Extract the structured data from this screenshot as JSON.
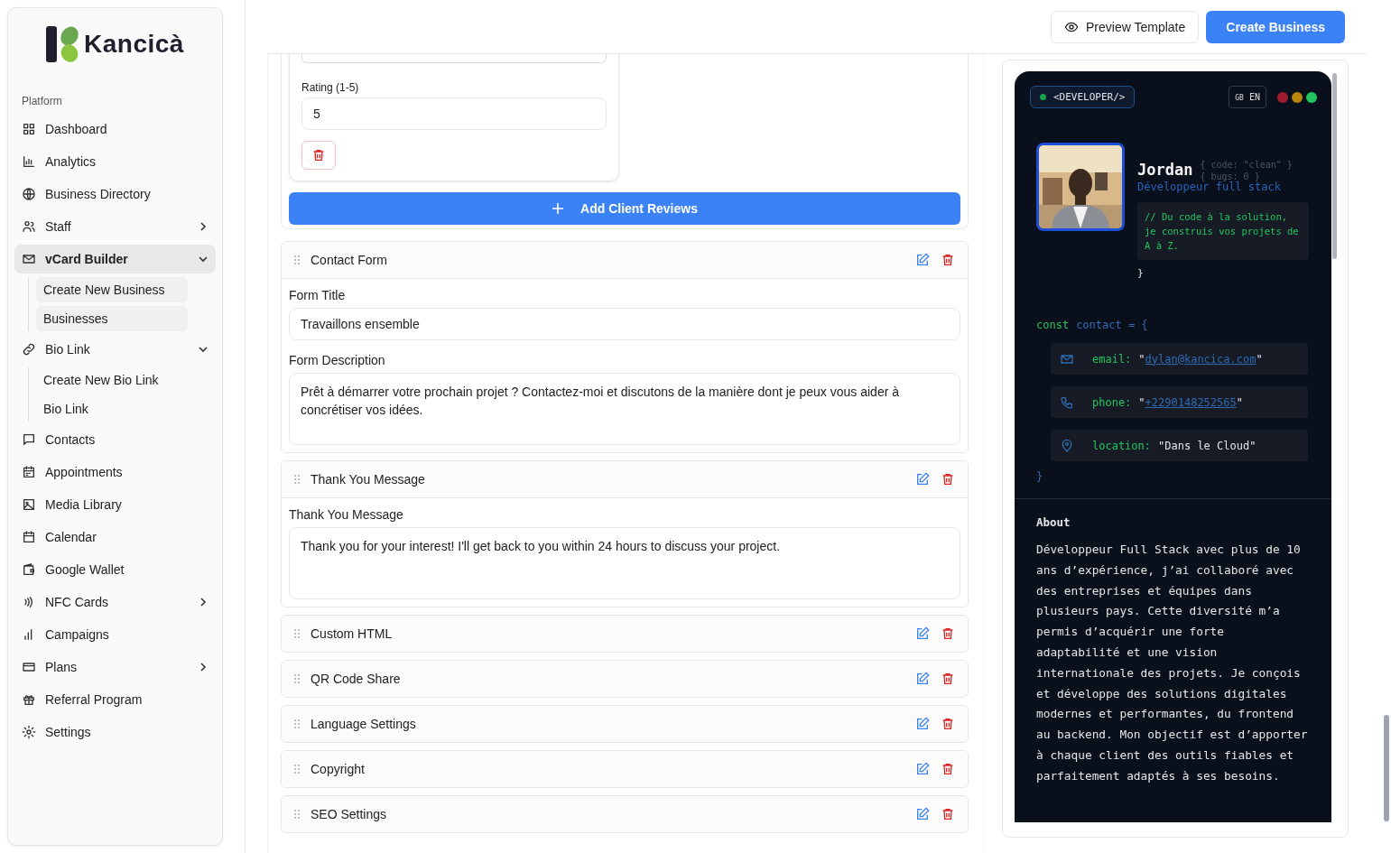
{
  "sidebar": {
    "logo": "Kancicà",
    "section": "Platform",
    "items": [
      {
        "label": "Dashboard",
        "selected": false
      },
      {
        "label": "Analytics",
        "selected": false
      },
      {
        "label": "Business Directory",
        "selected": false
      },
      {
        "label": "Staff",
        "selected": false,
        "expanded": false
      },
      {
        "label": "vCard Builder",
        "selected": true,
        "expanded": true,
        "children": [
          {
            "label": "Create New Business"
          },
          {
            "label": "Businesses"
          }
        ]
      },
      {
        "label": "Bio Link",
        "selected": false,
        "expanded": true,
        "children": [
          {
            "label": "Create New Bio Link"
          },
          {
            "label": "Bio Link"
          }
        ]
      },
      {
        "label": "Contacts",
        "selected": false
      },
      {
        "label": "Appointments",
        "selected": false
      },
      {
        "label": "Media Library",
        "selected": false
      },
      {
        "label": "Calendar",
        "selected": false
      },
      {
        "label": "Google Wallet",
        "selected": false
      },
      {
        "label": "NFC Cards",
        "selected": false,
        "expanded": false
      },
      {
        "label": "Campaigns",
        "selected": false
      },
      {
        "label": "Plans",
        "selected": false,
        "expanded": false
      },
      {
        "label": "Referral Program",
        "selected": false
      },
      {
        "label": "Settings",
        "selected": false
      }
    ]
  },
  "header": {
    "buttons": [
      {
        "label": "Preview Template",
        "kind": "secondary"
      },
      {
        "label": "Create Business",
        "kind": "primary"
      }
    ]
  },
  "editor": {
    "review": {
      "rating_label": "Rating (1-5)",
      "rating_value": "5"
    },
    "add_button": "Add Client Reviews",
    "sections": [
      {
        "title": "Contact Form",
        "expanded": true,
        "fields": [
          {
            "label": "Form Title",
            "value": "Travaillons ensemble",
            "kind": "input"
          },
          {
            "label": "Form Description",
            "value": "Prêt à démarrer votre prochain projet ? Contactez-moi et discutons de la manière dont je peux vous aider à concrétiser vos idées.",
            "kind": "textarea"
          }
        ]
      },
      {
        "title": "Thank You Message",
        "expanded": true,
        "fields": [
          {
            "label": "Thank You Message",
            "value": "Thank you for your interest! I'll get back to you within 24 hours to discuss your project.",
            "kind": "textarea"
          }
        ]
      },
      {
        "title": "Custom HTML",
        "expanded": false
      },
      {
        "title": "QR Code Share",
        "expanded": false
      },
      {
        "title": "Language Settings",
        "expanded": false
      },
      {
        "title": "Copyright",
        "expanded": false
      },
      {
        "title": "SEO Settings",
        "expanded": false
      }
    ]
  },
  "preview": {
    "badge": "<DEVELOPER/>",
    "language": {
      "flag": "GB",
      "code": "EN"
    },
    "window_dots": [
      {
        "color": "#9f1d2f"
      },
      {
        "color": "#b8860b"
      },
      {
        "color": "#22c55e"
      }
    ],
    "name": "Jordan",
    "code_comments": [
      "{ code: \"clean\" }",
      "{ bugs: 0 }"
    ],
    "role": "Développeur full stack",
    "tagline": "// Du code à la solution, je construis vos projets de A à Z.",
    "tagline_close": "}",
    "contact_keyword": "const",
    "contact_open": "contact = {",
    "contacts": [
      {
        "key": "email:",
        "open_quote": "\"",
        "value": "dylan@kancica.com",
        "close_quote": "\"",
        "link": true
      },
      {
        "key": "phone:",
        "open_quote": "\"",
        "value": "+2290148252565",
        "close_quote": "\"",
        "link": true
      },
      {
        "key": "location:",
        "open_quote": "\"",
        "value": "Dans le Cloud",
        "close_quote": "\"",
        "link": false
      }
    ],
    "contact_close": "}",
    "about_title": "About",
    "about_text": "Développeur Full Stack avec plus de 10 ans d’expérience, j’ai collaboré avec des entreprises et équipes dans plusieurs pays. Cette diversité m’a permis d’acquérir une forte adaptabilité et une vision internationale des projets. Je conçois et développe des solutions digitales modernes et performantes, du frontend au backend. Mon objectif est d’apporter à chaque client des outils fiables et parfaitement adaptés à ses besoins."
  }
}
